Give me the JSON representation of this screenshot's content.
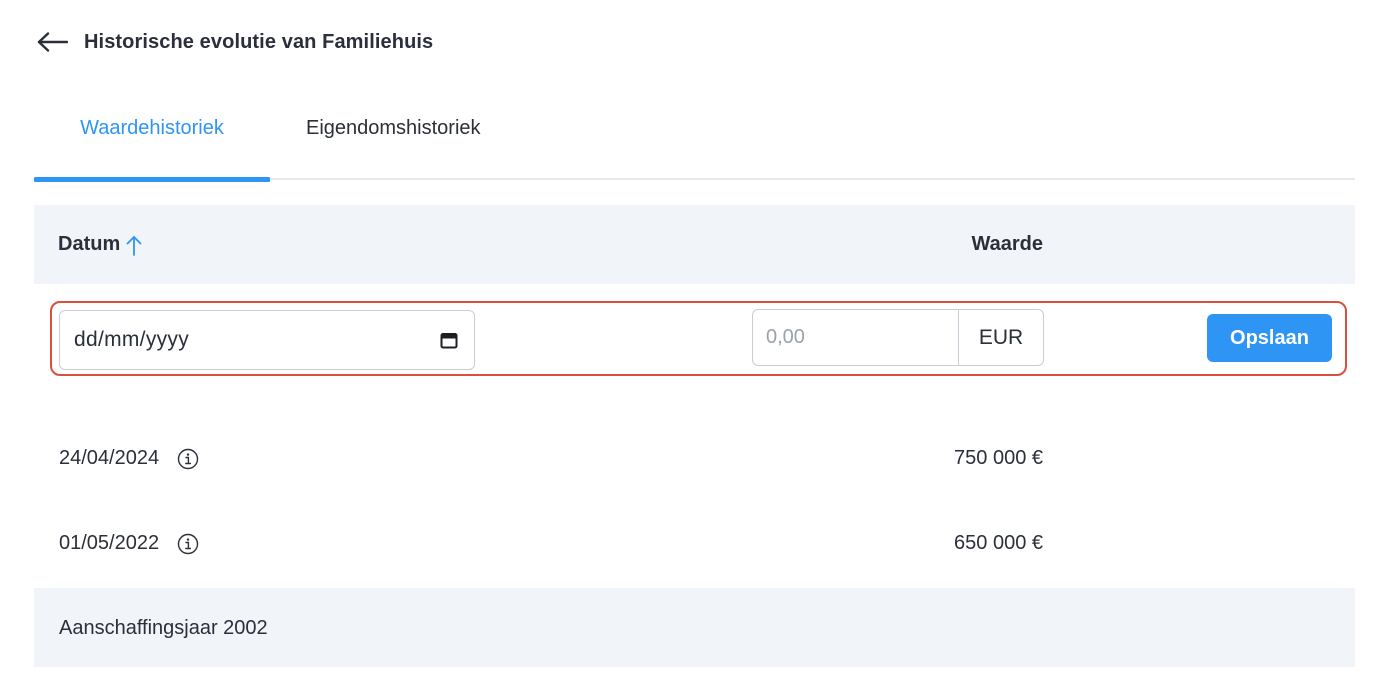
{
  "header": {
    "title": "Historische evolutie van Familiehuis",
    "back_icon": "arrow-left-icon"
  },
  "tabs": [
    {
      "label": "Waardehistoriek",
      "active": true
    },
    {
      "label": "Eigendomshistoriek",
      "active": false
    }
  ],
  "table": {
    "columns": {
      "date": "Datum",
      "value": "Waarde",
      "sort_icon": "arrow-up-icon",
      "sort_direction": "ascending"
    },
    "new_entry": {
      "date_placeholder": "dd/mm/yyyy",
      "calendar_icon": "calendar-icon",
      "value_placeholder": "0,00",
      "currency": "EUR",
      "save_label": "Opslaan"
    },
    "rows": [
      {
        "date": "24/04/2024",
        "value": "750 000 €",
        "icon": "info-icon"
      },
      {
        "date": "01/05/2022",
        "value": "650 000 €",
        "icon": "info-icon"
      }
    ],
    "footer": "Aanschaffingsjaar 2002"
  },
  "colors": {
    "accent": "#2e95f5",
    "highlight_border": "#d9503f",
    "header_bg": "#f1f4f9",
    "text": "#2b2f3b"
  }
}
